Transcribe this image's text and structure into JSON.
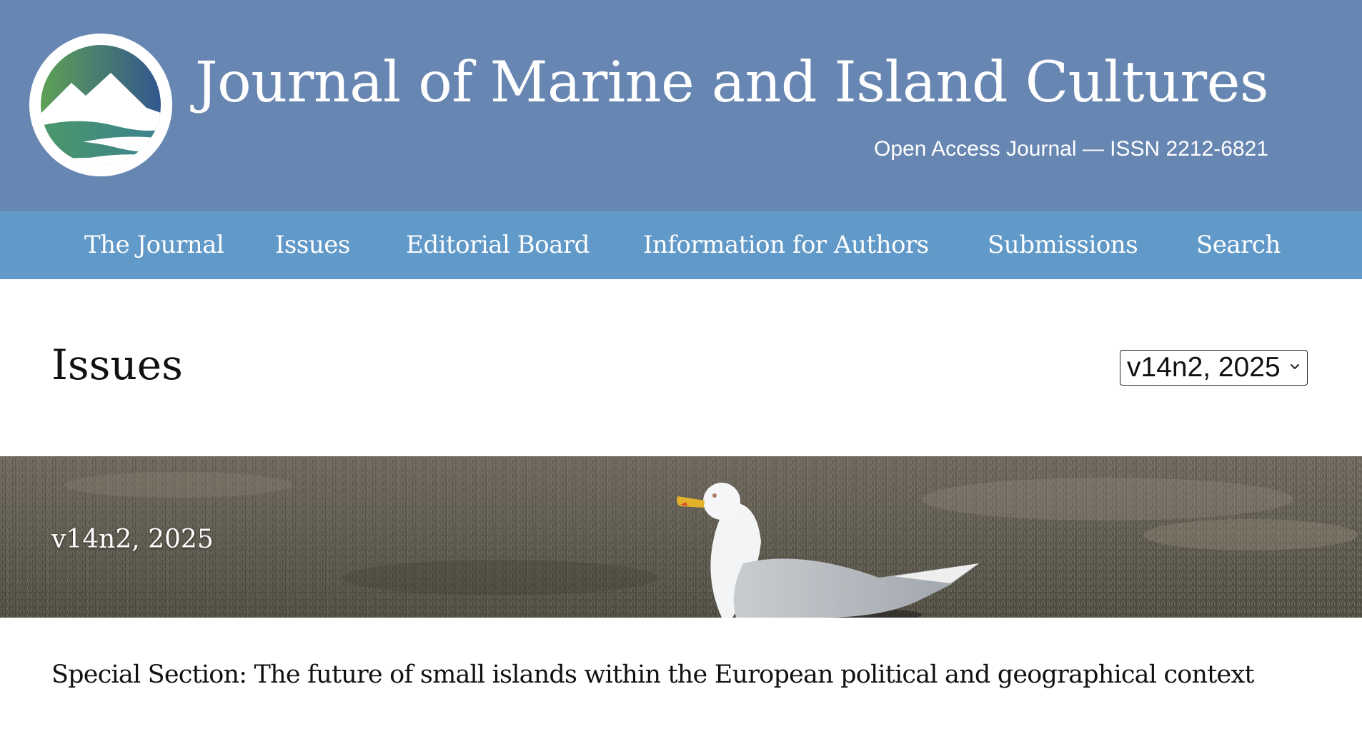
{
  "header": {
    "title": "Journal of Marine and Island Cultures",
    "subtitle": "Open Access Journal — ISSN 2212-6821",
    "logo_icon": "mountain-waves-logo-icon",
    "colors": {
      "header_bg": "#6786b2",
      "nav_bg": "#6199c8",
      "logo_green": "#5aa05a",
      "logo_blue": "#2f5596",
      "logo_teal": "#3b8a86"
    }
  },
  "nav": {
    "items": [
      {
        "label": "The Journal"
      },
      {
        "label": "Issues"
      },
      {
        "label": "Editorial Board"
      },
      {
        "label": "Information for Authors"
      },
      {
        "label": "Submissions"
      },
      {
        "label": "Search"
      }
    ]
  },
  "page": {
    "title": "Issues"
  },
  "issue_select": {
    "selected": "v14n2, 2025",
    "chevron_icon": "chevron-down-icon"
  },
  "banner": {
    "label": "v14n2, 2025",
    "image": "seagull-on-grass-photo"
  },
  "sections": {
    "heading": "Special Section: The future of small islands within the European political and geographical context"
  }
}
